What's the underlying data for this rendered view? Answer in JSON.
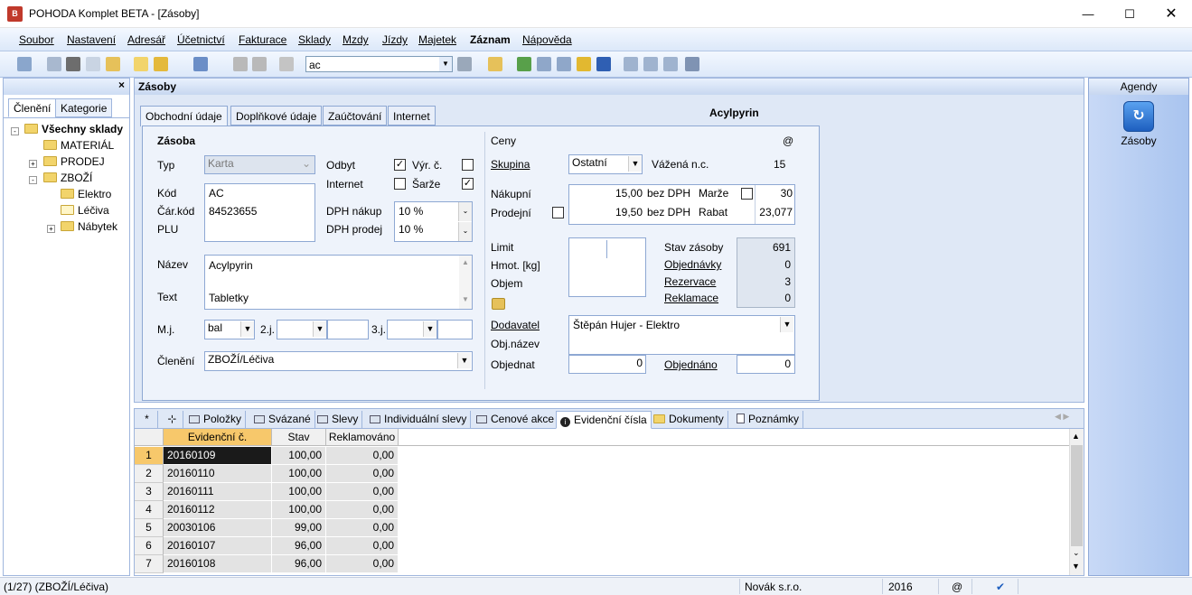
{
  "window": {
    "title": "POHODA Komplet BETA - [Zásoby]",
    "app_icon": "pohoda-logo-icon"
  },
  "menu": [
    "Soubor",
    "Nastavení",
    "Adresář",
    "Účetnictví",
    "Fakturace",
    "Sklady",
    "Mzdy",
    "Jízdy",
    "Majetek",
    "Záznam",
    "Nápověda"
  ],
  "toolbar": {
    "search_value": "ac"
  },
  "left_pane": {
    "close": "×",
    "tabs": [
      "Členění",
      "Kategorie"
    ],
    "tree": [
      {
        "label": "Všechny sklady",
        "bold": true
      },
      {
        "label": "MATERIÁL"
      },
      {
        "label": "PRODEJ"
      },
      {
        "label": "ZBOŽÍ"
      },
      {
        "label": "Elektro"
      },
      {
        "label": "Léčiva"
      },
      {
        "label": "Nábytek"
      }
    ]
  },
  "main": {
    "title": "Zásoby",
    "tabs": [
      "Obchodní údaje",
      "Doplňkové údaje",
      "Zaúčtování",
      "Internet"
    ],
    "product_name": "Acylpyrin",
    "zasoba": {
      "heading": "Zásoba",
      "typ_label": "Typ",
      "typ_value": "Karta",
      "odbyt_label": "Odbyt",
      "internet_label": "Internet",
      "vyr_c_label": "Výr. č.",
      "sarze_label": "Šarže",
      "odbyt_checked": true,
      "vyr_c_checked": false,
      "internet_checked": false,
      "sarze_checked": true,
      "kod_label": "Kód",
      "kod_value": "AC",
      "car_kod_label": "Čár.kód",
      "car_kod_value": "84523655",
      "plu_label": "PLU",
      "dph_nakup_label": "DPH nákup",
      "dph_nakup_value": "10 %",
      "dph_prodej_label": "DPH prodej",
      "dph_prodej_value": "10 %",
      "nazev_label": "Název",
      "nazev_value": "Acylpyrin",
      "text_label": "Text",
      "text_value": "Tabletky",
      "mj_label": "M.j.",
      "mj_value": "bal",
      "mj2_label": "2.j.",
      "mj3_label": "3.j.",
      "cleneni_label": "Členění",
      "cleneni_value": "ZBOŽÍ/Léčiva"
    },
    "ceny": {
      "heading": "Ceny",
      "at": "@",
      "skupina_label": "Skupina",
      "skupina_value": "Ostatní",
      "vazena_label": "Vážená n.c.",
      "vazena_value": "15",
      "nakupni_label": "Nákupní",
      "nakupni_value": "15,00",
      "nakupni_unit": "bez DPH",
      "prodejni_label": "Prodejní",
      "prodejni_value": "19,50",
      "prodejni_unit": "bez DPH",
      "marze_label": "Marže",
      "marze_value": "30",
      "rabat_label": "Rabat",
      "rabat_value": "23,077",
      "limit_label": "Limit",
      "hmot_label": "Hmot. [kg]",
      "objem_label": "Objem",
      "stav_label": "Stav zásoby",
      "stav_value": "691",
      "objednavky_label": "Objednávky",
      "objednavky_value": "0",
      "rezervace_label": "Rezervace",
      "rezervace_value": "3",
      "reklamace_label": "Reklamace",
      "reklamace_value": "0",
      "dodavatel_label": "Dodavatel",
      "dodavatel_value": "Štěpán Hujer - Elektro",
      "objnazev_label": "Obj.název",
      "objednat_label": "Objednat",
      "objednat_value": "0",
      "objednano_label": "Objednáno",
      "objednano_value": "0"
    }
  },
  "agendy": {
    "title": "Agendy",
    "item": "Zásoby"
  },
  "bottom": {
    "tabs": [
      "*",
      "Položky",
      "Svázané",
      "Slevy",
      "Individuální slevy",
      "Cenové akce",
      "Evidenční čísla",
      "Dokumenty",
      "Poznámky"
    ],
    "columns": [
      "Evidenční č.",
      "Stav",
      "Reklamováno"
    ],
    "rows": [
      [
        "20160109",
        "100,00",
        "0,00"
      ],
      [
        "20160110",
        "100,00",
        "0,00"
      ],
      [
        "20160111",
        "100,00",
        "0,00"
      ],
      [
        "20160112",
        "100,00",
        "0,00"
      ],
      [
        "20030106",
        "99,00",
        "0,00"
      ],
      [
        "20160107",
        "96,00",
        "0,00"
      ],
      [
        "20160108",
        "96,00",
        "0,00"
      ]
    ]
  },
  "status": {
    "record": "(1/27) (ZBOŽÍ/Léčiva)",
    "company": "Novák s.r.o.",
    "year": "2016",
    "at": "@"
  }
}
